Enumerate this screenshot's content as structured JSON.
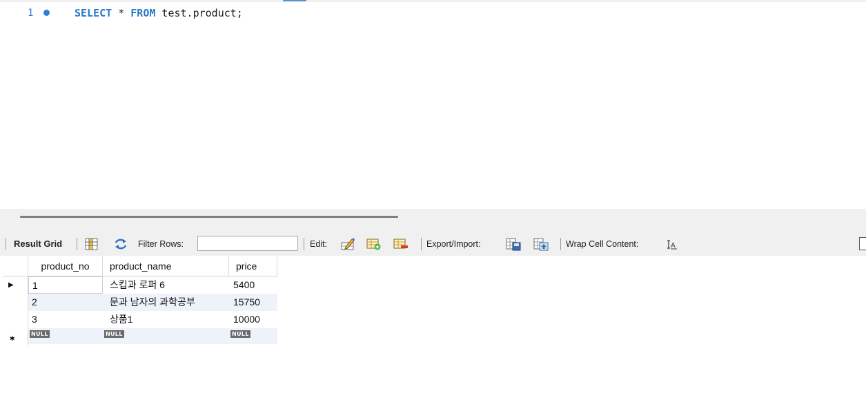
{
  "editor": {
    "line_number": "1",
    "sql": {
      "kw1": "SELECT",
      "mid": " * ",
      "kw2": "FROM",
      "rest": " test.product;"
    }
  },
  "toolbar": {
    "result_grid_label": "Result Grid",
    "filter_rows_label": "Filter Rows:",
    "filter_rows_value": "",
    "edit_label": "Edit:",
    "export_import_label": "Export/Import:",
    "wrap_cell_label": "Wrap Cell Content:"
  },
  "grid": {
    "columns": [
      "product_no",
      "product_name",
      "price"
    ],
    "rows": [
      [
        "1",
        "스킵과 로퍼 6",
        "5400"
      ],
      [
        "2",
        "문과 남자의 과학공부",
        "15750"
      ],
      [
        "3",
        "상품1",
        "10000"
      ]
    ],
    "null_label": "NULL",
    "current_row_marker": "▶",
    "new_row_marker": "✱"
  },
  "colors": {
    "keyword": "#2878c8",
    "line_number": "#3c7bd8",
    "toolbar_bg": "#f0f0f0",
    "alt_row": "#eef3fb"
  }
}
